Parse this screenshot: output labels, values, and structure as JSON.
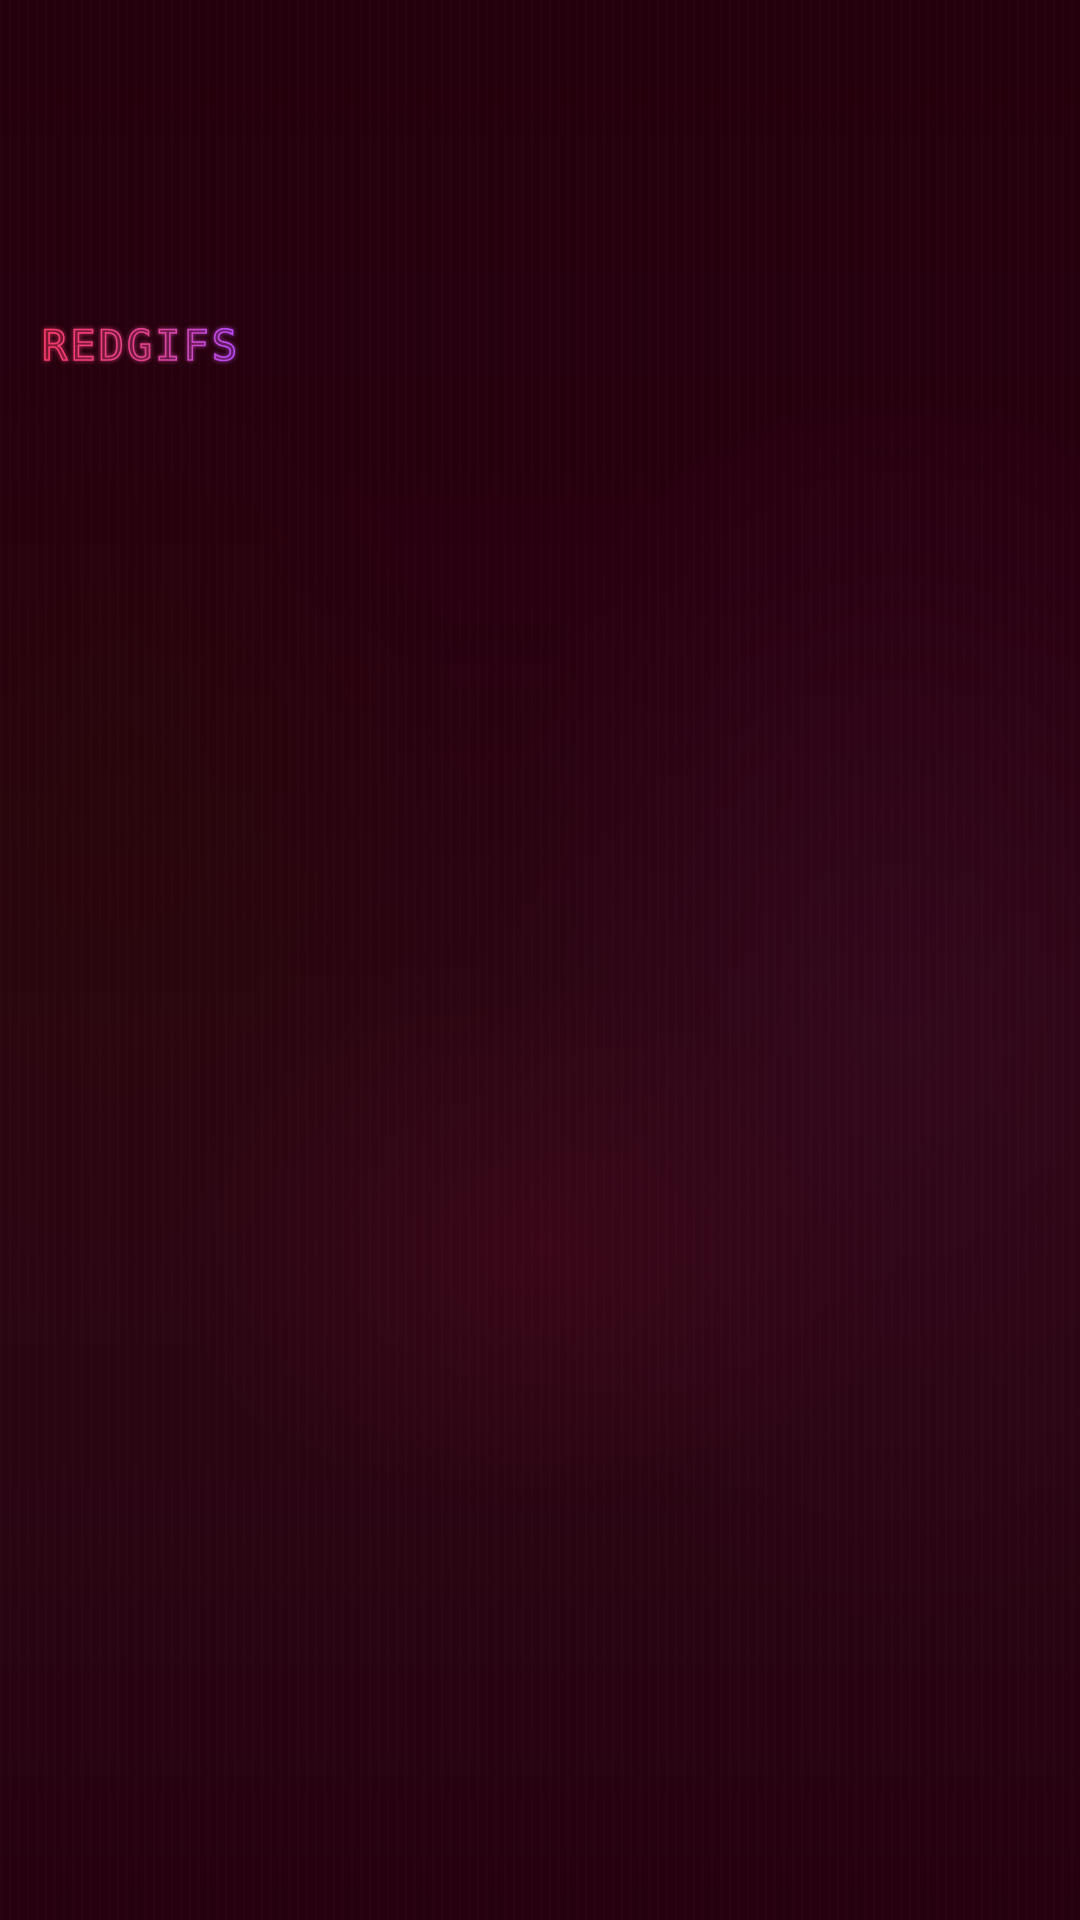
{
  "splash": {
    "logo_text": "REDGIFS",
    "logo_icon": "redgifs-wordmark"
  },
  "colors": {
    "background": "#26000e",
    "logo_gradient_start": "#ff3b6b",
    "logo_gradient_end": "#b84bff"
  }
}
